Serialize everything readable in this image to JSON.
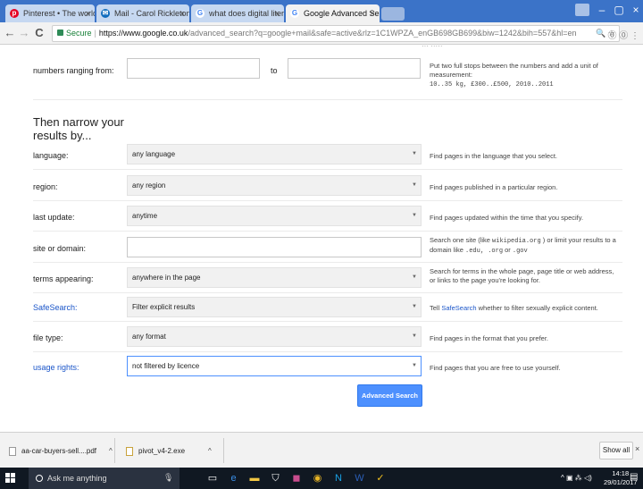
{
  "browser": {
    "tabs": [
      {
        "title": "Pinterest • The world's",
        "favicon": "pinterest-icon",
        "active": false
      },
      {
        "title": "Mail - Carol Rickleton - (",
        "favicon": "mail-icon",
        "active": false
      },
      {
        "title": "what does digital literacy",
        "favicon": "google-g-icon",
        "active": false
      },
      {
        "title": "Google Advanced Search",
        "favicon": "google-g-icon",
        "active": true
      }
    ],
    "tab_close": "×",
    "window_controls": {
      "minimize": "–",
      "maximize": "▢",
      "close": "×"
    },
    "nav": {
      "back": "←",
      "forward": "→",
      "reload": "C"
    },
    "address": {
      "secure_label": "Secure",
      "separator": "|",
      "url_host": "https://www.google.co.uk",
      "url_rest": "/advanced_search?q=google+mail&safe=active&rlz=1C1WPZA_enGB698GB699&biw=1242&bih=557&hl=en"
    },
    "omnibox_icons": "🔍 ☆",
    "extension_icons": "⓪ ⓪ ⋮"
  },
  "form": {
    "cutoff_text": "··· ·····",
    "range": {
      "label": "numbers ranging from:",
      "to_label": "to",
      "help": "Put two full stops between the numbers and add a unit of measurement:",
      "help_example": "10..35 kg, £300..£500, 2010..2011"
    },
    "narrow_title": "Then narrow your results by...",
    "rows": [
      {
        "label": "language:",
        "value": "any language",
        "help": "Find pages in the language that you select.",
        "link": false
      },
      {
        "label": "region:",
        "value": "any region",
        "help": "Find pages published in a particular region.",
        "link": false
      },
      {
        "label": "last update:",
        "value": "anytime",
        "help": "Find pages updated within the time that you specify.",
        "link": false
      }
    ],
    "site": {
      "label": "site or domain:",
      "value": "",
      "help_a": "Search one site (like ",
      "help_code1": "wikipedia.org",
      "help_b": " ) or limit your results to a domain like ",
      "help_code2": ".edu, .org",
      "help_c": " or ",
      "help_code3": ".gov"
    },
    "terms": {
      "label": "terms appearing:",
      "value": "anywhere in the page",
      "help": "Search for terms in the whole page, page title or web address, or links to the page you're looking for."
    },
    "safesearch": {
      "label": "SafeSearch:",
      "value": "Filter explicit results",
      "help_a": "Tell ",
      "help_link": "SafeSearch",
      "help_b": " whether to filter sexually explicit content."
    },
    "filetype": {
      "label": "file type:",
      "value": "any format",
      "help": "Find pages in the format that you prefer."
    },
    "rights": {
      "label": "usage rights:",
      "value": "not filtered by licence",
      "help": "Find pages that you are free to use yourself."
    },
    "submit_label": "Advanced Search",
    "caret": "▼"
  },
  "downloads": {
    "items": [
      {
        "name": "aa-car-buyers-sell....pdf",
        "icon": "pdf-file-icon"
      },
      {
        "name": "pivot_v4-2.exe",
        "icon": "exe-file-icon"
      }
    ],
    "chevron": "^",
    "show_all_label": "Show all",
    "close": "×"
  },
  "taskbar": {
    "search_placeholder": "Ask me anything",
    "mic": "🎙",
    "apps": [
      {
        "icon": "task-view-icon",
        "glyph": "▭",
        "color": "#ffffff"
      },
      {
        "icon": "edge-icon",
        "glyph": "e",
        "color": "#3a8ee6"
      },
      {
        "icon": "file-explorer-icon",
        "glyph": "▬",
        "color": "#f2c744"
      },
      {
        "icon": "store-icon",
        "glyph": "⛉",
        "color": "#ffffff"
      },
      {
        "icon": "photoshop-icon",
        "glyph": "◼",
        "color": "#c94d8e"
      },
      {
        "icon": "chrome-icon",
        "glyph": "◉",
        "color": "#e8b526"
      },
      {
        "icon": "app-n-icon",
        "glyph": "N",
        "color": "#1aa3e8"
      },
      {
        "icon": "word-icon",
        "glyph": "W",
        "color": "#2b5fb8"
      },
      {
        "icon": "norton-icon",
        "glyph": "✓",
        "color": "#f3c21f"
      }
    ],
    "tray": "^ ▣ ⁂ ◁)",
    "time": "14:18",
    "date": "29/01/2017",
    "notifications": "▤"
  },
  "colors": {
    "tabbar": "#3b73c8",
    "accent": "#4d90fe",
    "link": "#1a55c9"
  }
}
